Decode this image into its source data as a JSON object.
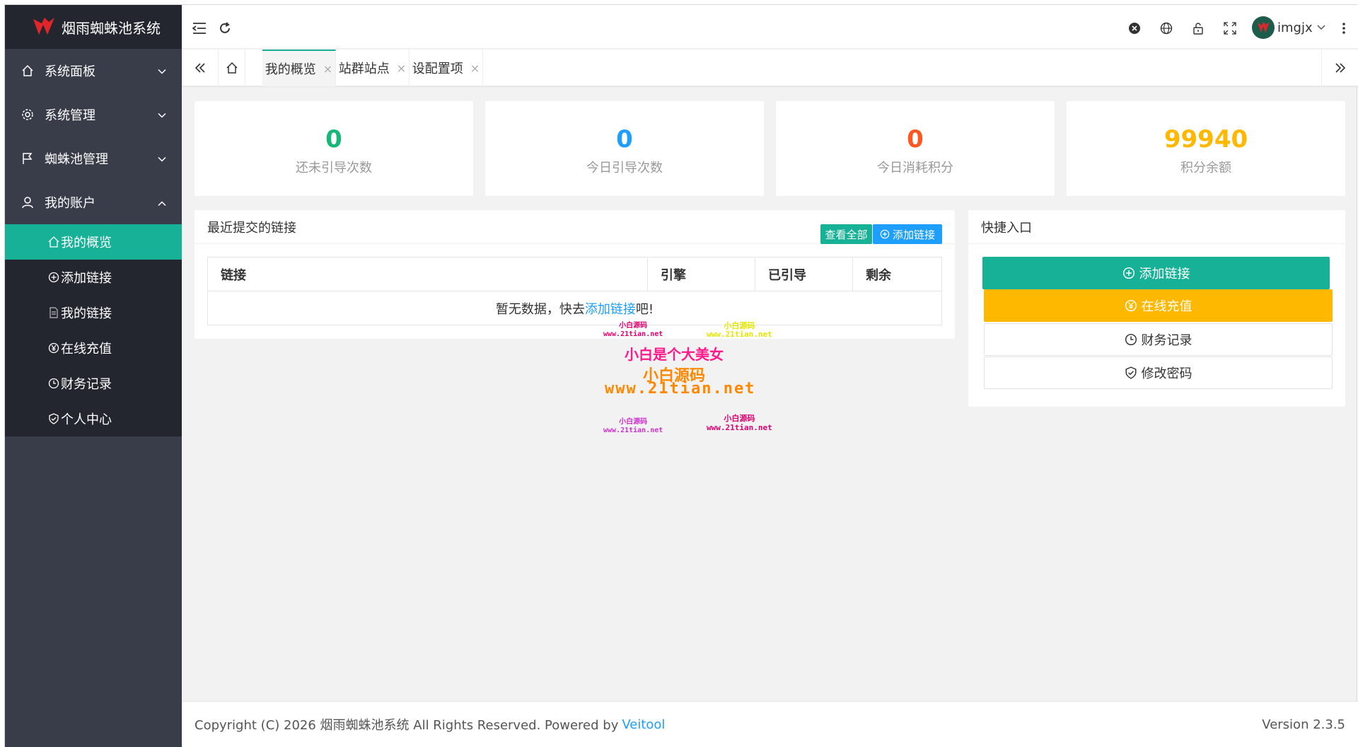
{
  "app": {
    "title": "烟雨蜘蛛池系统"
  },
  "sidebar": {
    "items": [
      {
        "label": "系统面板",
        "icon": "home-icon"
      },
      {
        "label": "系统管理",
        "icon": "gear-icon"
      },
      {
        "label": "蜘蛛池管理",
        "icon": "flag-icon"
      },
      {
        "label": "我的账户",
        "icon": "user-icon"
      }
    ],
    "sub_items": [
      {
        "label": "我的概览",
        "icon": "home-icon",
        "active": true
      },
      {
        "label": "添加链接",
        "icon": "plus-circle-icon"
      },
      {
        "label": "我的链接",
        "icon": "document-icon"
      },
      {
        "label": "在线充值",
        "icon": "yen-circle-icon"
      },
      {
        "label": "财务记录",
        "icon": "clock-icon"
      },
      {
        "label": "个人中心",
        "icon": "shield-check-icon"
      }
    ]
  },
  "header": {
    "user_name": "imgjx"
  },
  "tabs": [
    {
      "label": "我的概览",
      "active": true
    },
    {
      "label": "站群站点",
      "active": false
    },
    {
      "label": "设配置项",
      "active": false
    }
  ],
  "stats": [
    {
      "value": "0",
      "label": "还未引导次数",
      "color": "#16b777"
    },
    {
      "value": "0",
      "label": "今日引导次数",
      "color": "#1e9fff"
    },
    {
      "value": "0",
      "label": "今日消耗积分",
      "color": "#ff5722"
    },
    {
      "value": "99940",
      "label": "积分余额",
      "color": "#ffb800"
    }
  ],
  "recent": {
    "title": "最近提交的链接",
    "view_all": "查看全部",
    "add_link": "添加链接",
    "columns": [
      "链接",
      "引擎",
      "已引导",
      "剩余"
    ],
    "empty_prefix": "暂无数据，快去",
    "empty_link": "添加链接",
    "empty_suffix": "吧!"
  },
  "quick": {
    "title": "快捷入口",
    "buttons": [
      {
        "label": "添加链接",
        "icon": "plus-circle-icon"
      },
      {
        "label": "在线充值",
        "icon": "yen-circle-icon"
      },
      {
        "label": "财务记录",
        "icon": "clock-icon"
      },
      {
        "label": "修改密码",
        "icon": "shield-check-icon"
      }
    ]
  },
  "watermark": {
    "small1": "小白源码",
    "small1_url": "www.21tian.net",
    "line1": "小白是个大美女",
    "line2": "小白源码",
    "line3": "www.21tian.net"
  },
  "footer": {
    "copyright_prefix": "Copyright (C) 2026 烟雨蜘蛛池系统 All Rights Reserved. Powered by",
    "powered": "Veitool",
    "version": "Version 2.3.5"
  },
  "colors": {
    "accent": "#16b196",
    "orange": "#ffb800",
    "blue": "#1e9fff",
    "sidebar": "#393d49"
  }
}
